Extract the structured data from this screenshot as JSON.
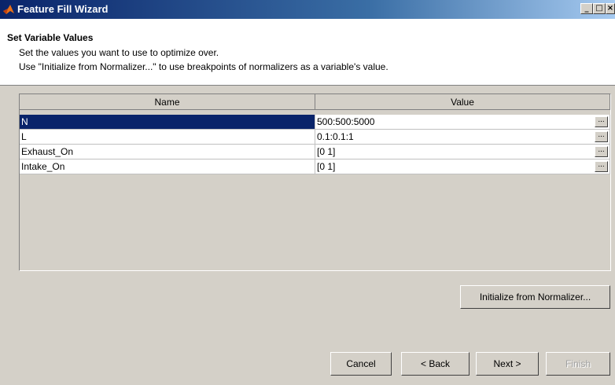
{
  "window": {
    "title": "Feature Fill Wizard",
    "controls": [
      "_",
      "□",
      "×"
    ]
  },
  "header": {
    "title": "Set Variable Values",
    "lines": [
      "Set the values you want to use to optimize over.",
      "Use \"Initialize from Normalizer...\" to use breakpoints of normalizers as a variable's value."
    ]
  },
  "table": {
    "columns": [
      "Name",
      "Value"
    ],
    "rows": [
      {
        "name": "N",
        "value": "500:500:5000"
      },
      {
        "name": "L",
        "value": "0.1:0.1:1"
      },
      {
        "name": "Exhaust_On",
        "value": "[0 1]"
      },
      {
        "name": "Intake_On",
        "value": "[0 1]"
      }
    ],
    "ellipsis_label": "..."
  },
  "buttons": {
    "initialize": "Initialize from Normalizer...",
    "cancel": "Cancel",
    "back": "< Back",
    "next": "Next >",
    "finish": "Finish"
  }
}
